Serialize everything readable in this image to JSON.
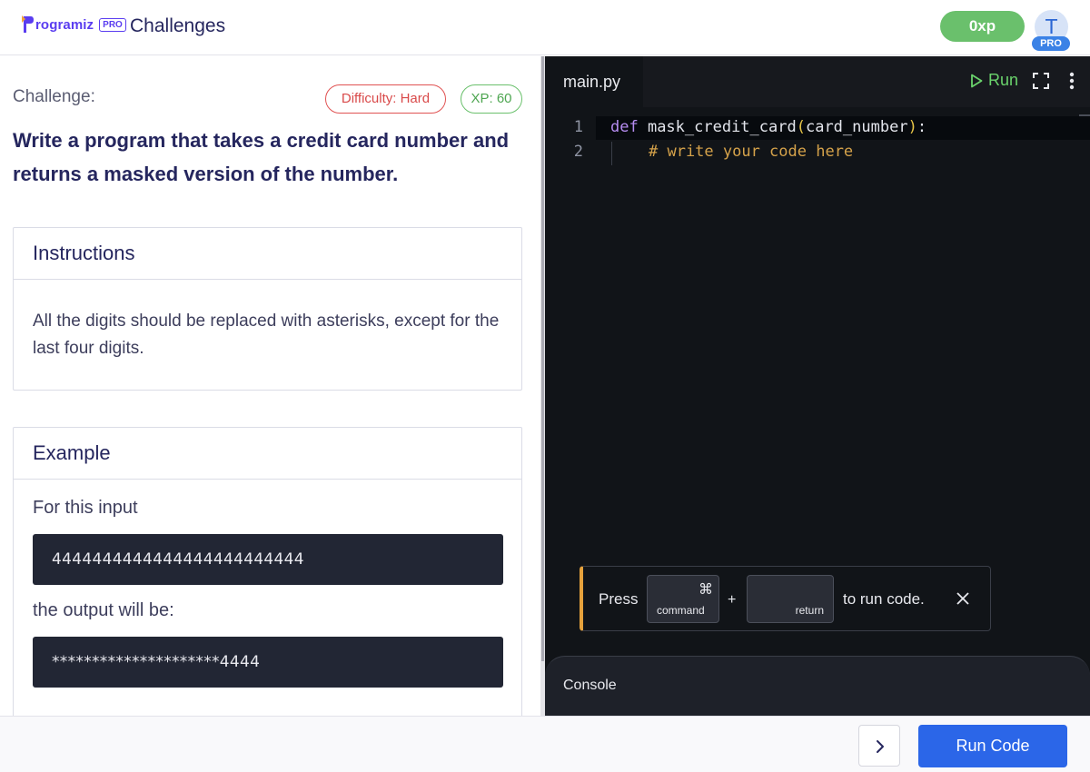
{
  "header": {
    "logo_text": "rogramiz",
    "logo_badge": "PRO",
    "title": "Challenges",
    "xp": "0xp",
    "avatar_initial": "T",
    "avatar_badge": "PRO"
  },
  "challenge": {
    "label": "Challenge:",
    "difficulty": "Difficulty: Hard",
    "xp": "XP: 60",
    "title": "Write a program that takes a credit card number and returns a masked version of the number."
  },
  "instructions": {
    "heading": "Instructions",
    "text": "All the digits should be replaced with asterisks, except for the last four digits."
  },
  "example": {
    "heading": "Example",
    "input_label": "For this input",
    "input_value": "4444444444444444444444444",
    "output_label": "the output will be:",
    "output_value": "*********************4444"
  },
  "editor": {
    "tab": "main.py",
    "run_label": "Run",
    "lines": [
      {
        "num": "1",
        "kw": "def ",
        "name": "mask_credit_card",
        "open": "(",
        "arg": "card_number",
        "close": ")",
        "colon": ":"
      },
      {
        "num": "2",
        "comment": "# write your code here"
      }
    ],
    "hint": {
      "press": "Press",
      "key1_symbol": "⌘",
      "key1_label": "command",
      "plus": "+",
      "key2_label": "return",
      "suffix": "to run code."
    },
    "console_label": "Console"
  },
  "footer": {
    "run_code": "Run Code"
  },
  "colors": {
    "brand": "#5a3df0",
    "xp_green": "#6ac06c",
    "hard_red": "#d94a4a",
    "primary_blue": "#2b66e8",
    "editor_bg": "#111418",
    "hint_accent": "#e6a23c"
  },
  "icons": [
    "programiz-logo-icon",
    "play-icon",
    "expand-icon",
    "more-vertical-icon",
    "close-icon",
    "chevron-right-icon"
  ]
}
